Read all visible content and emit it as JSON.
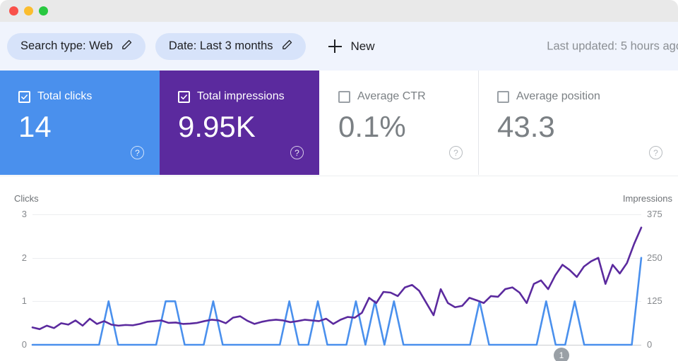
{
  "window": {
    "lights": [
      {
        "name": "close",
        "color": "#f9514a"
      },
      {
        "name": "minimize",
        "color": "#fbbd2e"
      },
      {
        "name": "zoom",
        "color": "#28c840"
      }
    ]
  },
  "toolbar": {
    "chips": [
      {
        "label": "Search type: Web",
        "icon": "pencil-icon"
      },
      {
        "label": "Date: Last 3 months",
        "icon": "pencil-icon"
      }
    ],
    "new_label": "New",
    "last_updated": "Last updated: 5 hours ago"
  },
  "cards": [
    {
      "label": "Total clicks",
      "value": "14",
      "checked": true,
      "bg": "#4a90ed",
      "help": "?"
    },
    {
      "label": "Total impressions",
      "value": "9.95K",
      "checked": true,
      "bg": "#5b2a9e",
      "help": "?"
    },
    {
      "label": "Average CTR",
      "value": "0.1%",
      "checked": false,
      "bg": "#ffffff",
      "help": "?"
    },
    {
      "label": "Average position",
      "value": "43.3",
      "checked": false,
      "bg": "#ffffff",
      "help": "?"
    }
  ],
  "chart_footer_badge": "1",
  "chart_data": {
    "type": "line",
    "title": "",
    "xlabel": "",
    "grid": true,
    "legend_position": "none",
    "axes": {
      "left": {
        "label": "Clicks",
        "ticks": [
          3,
          2,
          1,
          0
        ],
        "min": 0,
        "max": 3,
        "color": "#4a90ed"
      },
      "right": {
        "label": "Impressions",
        "ticks": [
          375,
          250,
          125,
          0
        ],
        "min": 0,
        "max": 375,
        "color": "#5b2a9e"
      }
    },
    "series": [
      {
        "name": "Clicks",
        "axis": "left",
        "color": "#4a90ed",
        "values": [
          0,
          0,
          0,
          0,
          0,
          0,
          0,
          0,
          1,
          0,
          0,
          0,
          0,
          0,
          1,
          1,
          0,
          0,
          0,
          1,
          0,
          0,
          0,
          0,
          0,
          0,
          0,
          1,
          0,
          0,
          1,
          0,
          0,
          0,
          1,
          0,
          1,
          0,
          1,
          0,
          0,
          0,
          0,
          0,
          0,
          0,
          0,
          1,
          0,
          0,
          0,
          0,
          0,
          0,
          1,
          0,
          0,
          1,
          0,
          0,
          0,
          0,
          0,
          0,
          2
        ]
      },
      {
        "name": "Impressions",
        "axis": "right",
        "color": "#5b2a9e",
        "values": [
          50,
          45,
          55,
          48,
          62,
          58,
          70,
          55,
          75,
          60,
          68,
          58,
          55,
          57,
          56,
          60,
          66,
          68,
          70,
          63,
          64,
          60,
          61,
          63,
          68,
          72,
          70,
          62,
          78,
          82,
          69,
          60,
          66,
          70,
          72,
          70,
          65,
          68,
          72,
          70,
          68,
          75,
          60,
          72,
          80,
          78,
          92,
          135,
          120,
          152,
          150,
          140,
          165,
          172,
          155,
          120,
          85,
          160,
          120,
          108,
          112,
          135,
          128,
          120,
          140,
          138,
          160,
          165,
          150,
          120,
          175,
          185,
          160,
          200,
          230,
          215,
          195,
          225,
          240,
          250,
          175,
          230,
          205,
          235,
          290,
          337
        ]
      }
    ]
  }
}
